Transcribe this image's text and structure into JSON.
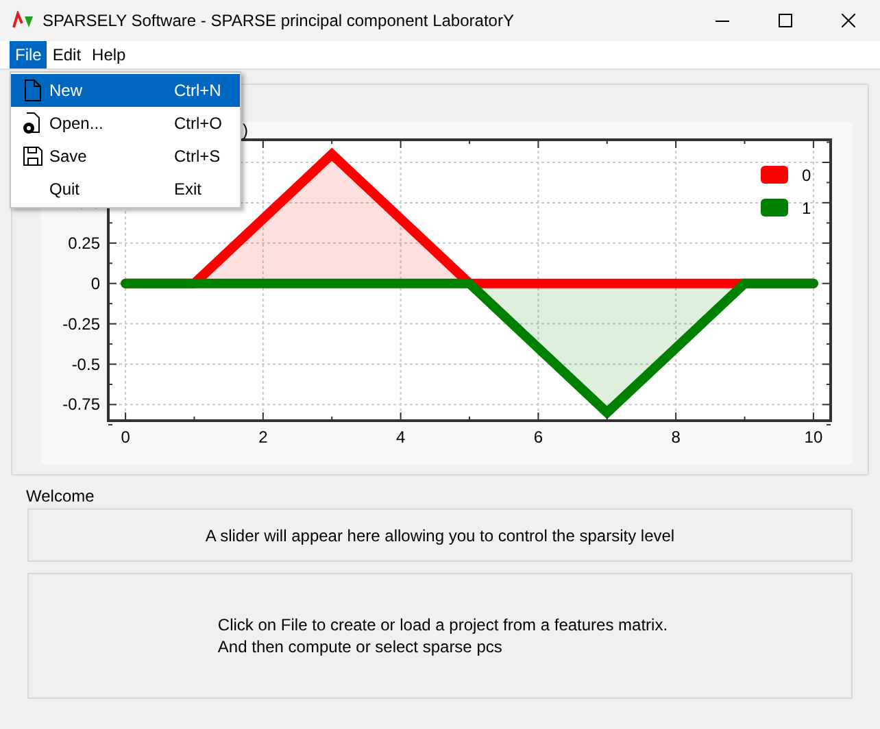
{
  "window": {
    "title": "SPARSELY Software - SPARSE principal component LaboratorY"
  },
  "menubar": [
    {
      "label": "File",
      "selected": true
    },
    {
      "label": "Edit",
      "selected": false
    },
    {
      "label": "Help",
      "selected": false
    }
  ],
  "file_menu": [
    {
      "kind": "new",
      "label": "New",
      "shortcut": "Ctrl+N",
      "selected": true
    },
    {
      "kind": "open",
      "label": "Open...",
      "shortcut": "Ctrl+O",
      "selected": false
    },
    {
      "kind": "save",
      "label": "Save",
      "shortcut": "Ctrl+S",
      "selected": false
    },
    {
      "kind": "none",
      "label": "Quit",
      "shortcut": "Exit",
      "selected": false
    }
  ],
  "plot": {
    "title_fragment": ")",
    "chart_data": {
      "type": "area",
      "x": [
        0,
        1,
        3,
        5,
        7,
        9,
        10
      ],
      "series": [
        {
          "name": "0",
          "color": "#ff0000",
          "values": [
            0,
            0,
            0.8,
            0,
            0,
            0,
            0
          ]
        },
        {
          "name": "1",
          "color": "#008000",
          "values": [
            0,
            0,
            0,
            0,
            -0.8,
            0,
            0
          ]
        }
      ],
      "grid": true,
      "legend": true,
      "xlim": [
        -0.25,
        10.25
      ],
      "ylim": [
        -0.85,
        0.89
      ],
      "xticks": [
        0,
        2,
        4,
        6,
        8,
        10
      ],
      "yticks": [
        0.5,
        0.25,
        0,
        -0.25,
        -0.5,
        -0.75
      ]
    }
  },
  "welcome_label": "Welcome",
  "slider_placeholder": "A slider will appear here allowing you to control the sparsity level",
  "instructions": [
    "Click on File to create or load a project from a features matrix.",
    "And then compute or select sparse pcs"
  ]
}
